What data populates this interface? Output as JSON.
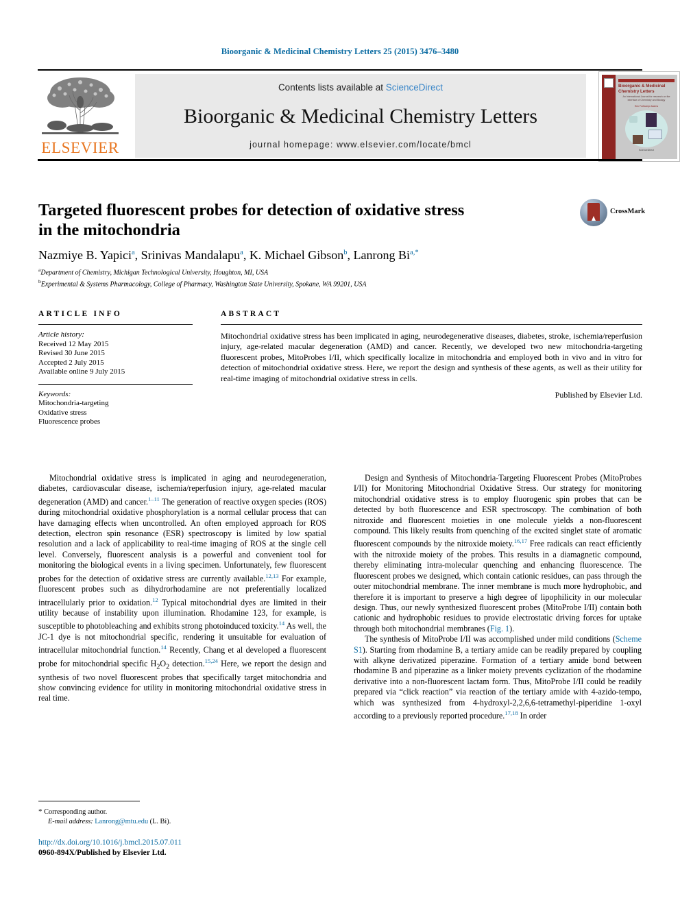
{
  "running_head": "Bioorganic & Medicinal Chemistry Letters 25 (2015) 3476–3480",
  "masthead": {
    "contents_prefix": "Contents lists available at ",
    "sciencedirect": "ScienceDirect",
    "journal_name": "Bioorganic & Medicinal Chemistry Letters",
    "homepage": "journal homepage: www.elsevier.com/locate/bmcl",
    "publisher_wordmark": "ELSEVIER",
    "cover": {
      "title": "Bioorganic & Medicinal Chemistry Letters",
      "subtitle": "An International Journal for research on the interface of Chemistry and Biology",
      "editors": "Eric Fortkamp Adams",
      "footer": "ScienceDirect"
    }
  },
  "article": {
    "title_line1": "Targeted fluorescent probes for detection of oxidative stress",
    "title_line2": "in the mitochondria",
    "authors": [
      {
        "name": "Nazmiye B. Yapici",
        "sup": "a",
        "sep": ", "
      },
      {
        "name": "Srinivas Mandalapu",
        "sup": "a",
        "sep": ", "
      },
      {
        "name": "K. Michael Gibson",
        "sup": "b",
        "sep": ", "
      },
      {
        "name": "Lanrong Bi",
        "sup": "a,*",
        "sep": ""
      }
    ],
    "affiliations": [
      {
        "marker": "a",
        "text": "Department of Chemistry, Michigan Technological University, Houghton, MI, USA"
      },
      {
        "marker": "b",
        "text": "Experimental & Systems Pharmacology, College of Pharmacy, Washington State University, Spokane, WA 99201, USA"
      }
    ],
    "crossmark_label": "CrossMark"
  },
  "article_info": {
    "heading": "ARTICLE INFO",
    "history_label": "Article history:",
    "history": [
      "Received 12 May 2015",
      "Revised 30 June 2015",
      "Accepted 2 July 2015",
      "Available online 9 July 2015"
    ],
    "keywords_label": "Keywords:",
    "keywords": [
      "Mitochondria-targeting",
      "Oxidative stress",
      "Fluorescence probes"
    ]
  },
  "abstract": {
    "heading": "ABSTRACT",
    "text": "Mitochondrial oxidative stress has been implicated in aging, neurodegenerative diseases, diabetes, stroke, ischemia/reperfusion injury, age-related macular degeneration (AMD) and cancer. Recently, we developed two new mitochondria-targeting fluorescent probes, MitoProbes I/II, which specifically localize in mitochondria and employed both in vivo and in vitro for detection of mitochondrial oxidative stress. Here, we report the design and synthesis of these agents, as well as their utility for real-time imaging of mitochondrial oxidative stress in cells.",
    "published_by": "Published by Elsevier Ltd."
  },
  "body": {
    "left_paragraph_parts": {
      "p1_a": "Mitochondrial oxidative stress is implicated in aging and neurodegeneration, diabetes, cardiovascular disease, ischemia/reperfusion injury, age-related macular degeneration (AMD) and cancer.",
      "p1_ref1": "1–11",
      "p1_b": " The generation of reactive oxygen species (ROS) during mitochondrial oxidative phosphorylation is a normal cellular process that can have damaging effects when uncontrolled. An often employed approach for ROS detection, electron spin resonance (ESR) spectroscopy is limited by low spatial resolution and a lack of applicability to real-time imaging of ROS at the single cell level. Conversely, fluorescent analysis is a powerful and convenient tool for monitoring the biological events in a living specimen. Unfortunately, few fluorescent probes for the detection of oxidative stress are currently available.",
      "p1_ref2": "12,13",
      "p1_c": " For example, fluorescent probes such as dihydrorhodamine are not preferentially localized intracellularly prior to oxidation.",
      "p1_ref3": "12",
      "p1_d": " Typical mitochondrial dyes are limited in their utility because of instability upon illumination. Rhodamine 123, for example, is susceptible to photobleaching and exhibits strong photoinduced toxicity.",
      "p1_ref4": "14",
      "p1_e": " As well, the JC-1 dye is not mitochondrial specific, rendering it unsuitable for evaluation of intracellular mitochondrial function.",
      "p1_ref5": "14",
      "p1_f": " Recently, Chang et al developed a fluorescent probe for mitochondrial specific H",
      "p1_sub1": "2",
      "p1_g": "O",
      "p1_sub2": "2",
      "p1_h": " detection.",
      "p1_ref6": "15,24",
      "p1_i": " Here, we report the design and synthesis of two novel fluorescent probes that specifically target mitochondria and show convincing evidence for utility in monitoring mitochondrial oxidative stress in real time."
    },
    "right_paragraph_parts": {
      "p2_a": "Design and Synthesis of Mitochondria-Targeting Fluorescent Probes (MitoProbes I/II) for Monitoring Mitochondrial Oxidative Stress. Our strategy for monitoring mitochondrial oxidative stress is to employ fluorogenic spin probes that can be detected by both fluorescence and ESR spectroscopy. The combination of both nitroxide and fluorescent moieties in one molecule yields a non-fluorescent compound. This likely results from quenching of the excited singlet state of aromatic fluorescent compounds by the nitroxide moiety.",
      "p2_ref1": "16,17",
      "p2_b": " Free radicals can react efficiently with the nitroxide moiety of the probes. This results in a diamagnetic compound, thereby eliminating intra-molecular quenching and enhancing fluorescence. The fluorescent probes we designed, which contain cationic residues, can pass through the outer mitochondrial membrane. The inner membrane is much more hydrophobic, and therefore it is important to preserve a high degree of lipophilicity in our molecular design. Thus, our newly synthesized fluorescent probes (MitoProbe I/II) contain both cationic and hydrophobic residues to provide electrostatic driving forces for uptake through both mitochondrial membranes (",
      "p2_link1": "Fig. 1",
      "p2_c": ").",
      "p3_a": "The synthesis of MitoProbe I/II was accomplished under mild conditions (",
      "p3_link1": "Scheme S1",
      "p3_b": "). Starting from rhodamine B, a tertiary amide can be readily prepared by coupling with alkyne derivatized piperazine. Formation of a tertiary amide bond between rhodamine B and piperazine as a linker moiety prevents cyclization of the rhodamine derivative into a non-fluorescent lactam form. Thus, MitoProbe I/II could be readily prepared via “click reaction” via reaction of the tertiary amide with 4-azido-tempo, which was synthesized from 4-hydroxyl-2,2,6,6-tetramethyl-piperidine 1-oxyl according to a previously reported procedure.",
      "p3_ref1": "17,18",
      "p3_c": " In order"
    }
  },
  "footer": {
    "corresponding_marker": "*",
    "corresponding_label": "Corresponding author.",
    "email_label": "E-mail address:",
    "email": "Lanrong@mtu.edu",
    "email_owner": "(L. Bi).",
    "doi": "http://dx.doi.org/10.1016/j.bmcl.2015.07.011",
    "issn_line": "0960-894X/Published by Elsevier Ltd."
  },
  "colors": {
    "link_blue": "#0a6ba2",
    "elsevier_orange": "#e87722",
    "sciencedirect_blue": "#3a86c8",
    "band_gray": "#e9e9e9"
  }
}
